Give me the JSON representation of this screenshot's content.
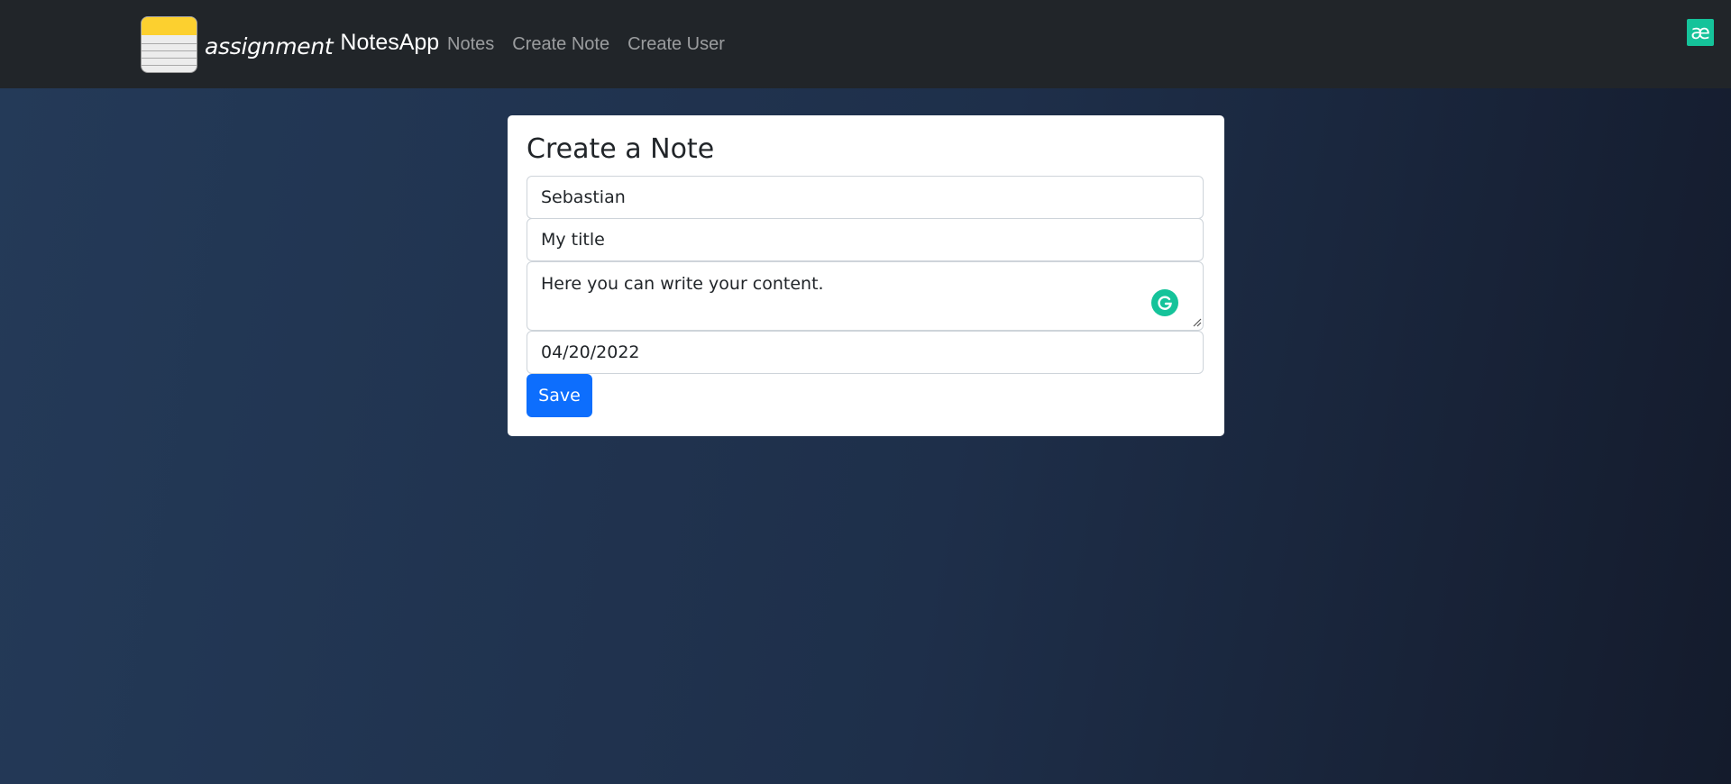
{
  "nav": {
    "brand_word": "assignment",
    "brand_name": "NotesApp",
    "links": [
      "Notes",
      "Create Note",
      "Create User"
    ],
    "extension_glyph": "æ"
  },
  "form": {
    "title": "Create a Note",
    "author_value": "Sebastian",
    "title_value": "My title",
    "content_value": "Here you can write your content.",
    "date_value": "04/20/2022",
    "save_label": "Save"
  },
  "colors": {
    "navbar": "#212529",
    "primary": "#0d6efd",
    "grammarly": "#15c39a"
  },
  "icons": {
    "logo": "notepad-icon",
    "extension": "extension-icon",
    "grammarly": "grammarly-icon"
  }
}
